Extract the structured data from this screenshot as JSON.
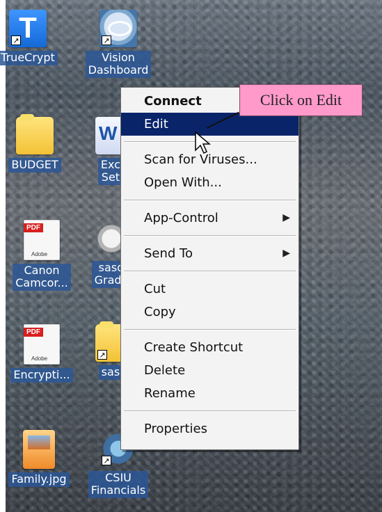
{
  "desktop": {
    "icons": [
      {
        "label": "TrueCrypt",
        "icon": "truecrypt-icon",
        "shortcut": true
      },
      {
        "label": "Vision\nDashboard",
        "icon": "vision-dashboard-icon",
        "shortcut": true
      },
      {
        "label": "BUDGET",
        "icon": "folder-icon",
        "shortcut": false
      },
      {
        "label": "Exch\nSetu",
        "icon": "exchange-setup-icon",
        "shortcut": false
      },
      {
        "label": "Canon\nCamcor...",
        "icon": "pdf-icon",
        "shortcut": false
      },
      {
        "label": "sasd\nGrade",
        "icon": "gear-app-icon",
        "shortcut": false
      },
      {
        "label": "Encrypti...",
        "icon": "pdf-icon",
        "shortcut": false
      },
      {
        "label": "sasd",
        "icon": "folder-icon",
        "shortcut": true
      },
      {
        "label": "Family.jpg",
        "icon": "image-file-icon",
        "shortcut": false
      },
      {
        "label": "CSIU\nFinancials",
        "icon": "csiu-financials-icon",
        "shortcut": true
      }
    ]
  },
  "context_menu": {
    "items": {
      "connect": "Connect",
      "edit": "Edit",
      "scan": "Scan for Viruses...",
      "open_with": "Open With...",
      "app_control": "App-Control",
      "send_to": "Send To",
      "cut": "Cut",
      "copy": "Copy",
      "create_shortcut": "Create Shortcut",
      "delete": "Delete",
      "rename": "Rename",
      "properties": "Properties"
    }
  },
  "callout": {
    "text": "Click on Edit"
  },
  "colors": {
    "menu_background": "#f3f3f3",
    "menu_selection": "#0a246a",
    "callout_background": "#ff9acb",
    "desktop_label_background": "#2b5796"
  }
}
